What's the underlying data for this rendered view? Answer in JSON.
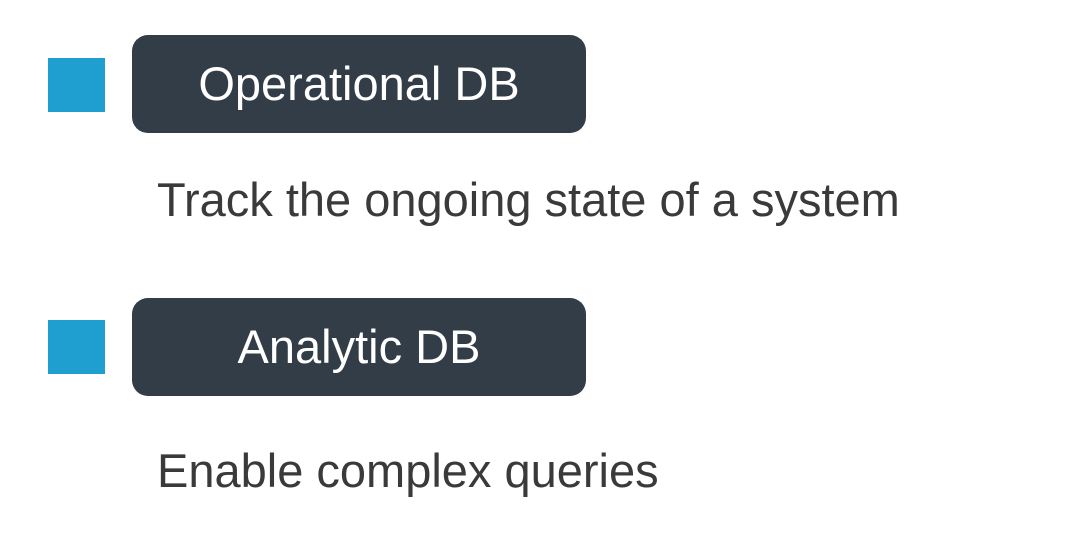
{
  "items": [
    {
      "label": "Operational DB",
      "description": "Track the ongoing state of a system"
    },
    {
      "label": "Analytic DB",
      "description": "Enable complex queries"
    }
  ],
  "colors": {
    "bullet": "#1f9fcf",
    "pill_background": "#333d47",
    "pill_text": "#ffffff",
    "description_text": "#3a3a3a",
    "background": "#ffffff"
  }
}
